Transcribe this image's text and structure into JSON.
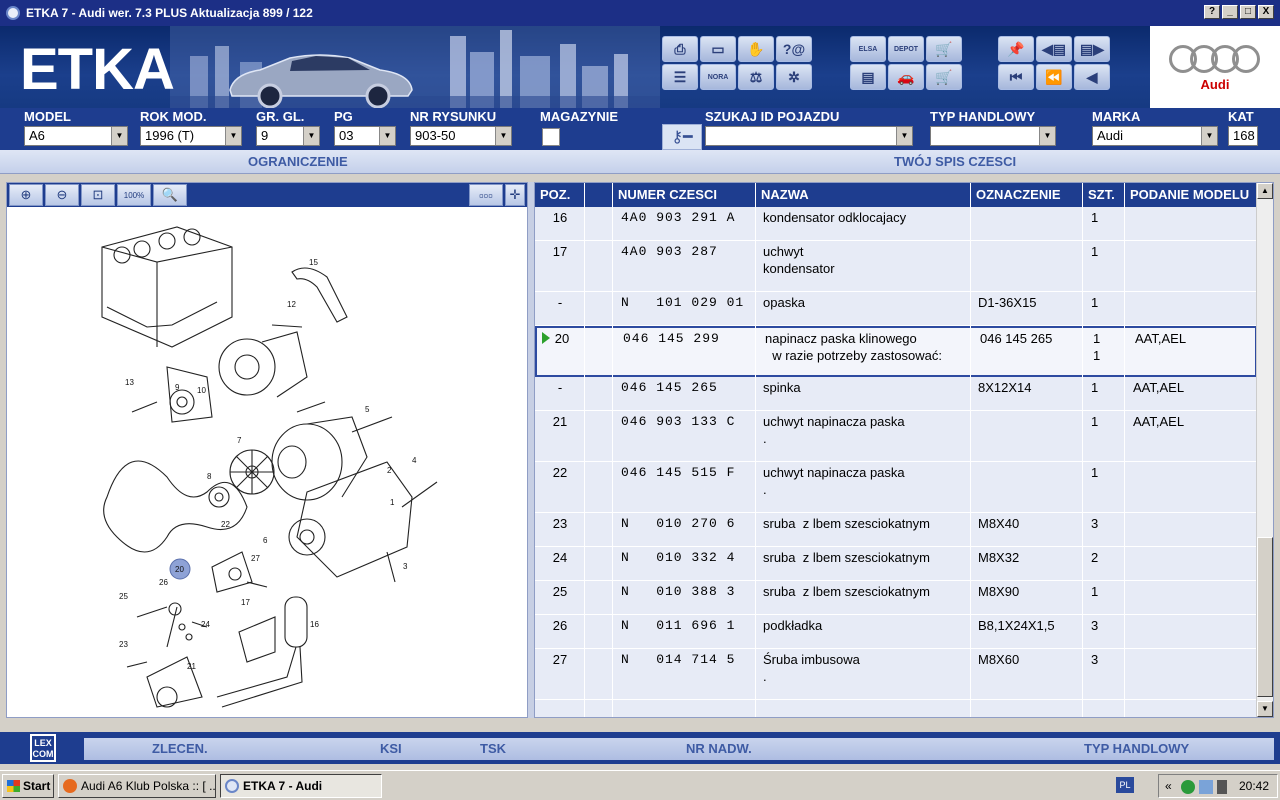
{
  "window": {
    "title": "ETKA 7 - Audi wer. 7.3 PLUS Aktualizacja 899 / 122",
    "buttons": [
      "?",
      "_",
      "□",
      "X"
    ]
  },
  "banner": {
    "logo": "ETKA",
    "brand": "Audi",
    "icon_labels": {
      "elsa": "ELSA",
      "depot": "DEPOT",
      "nora": "NORA"
    }
  },
  "selectors": {
    "model": {
      "label": "MODEL",
      "value": "A6"
    },
    "rok_mod": {
      "label": "ROK MOD.",
      "value": "1996 (T)"
    },
    "gr_gl": {
      "label": "GR. GL.",
      "value": "9"
    },
    "pg": {
      "label": "PG",
      "value": "03"
    },
    "nr_rysunku": {
      "label": "NR RYSUNKU",
      "value": "903-50"
    },
    "magazynie": {
      "label": "MAGAZYNIE"
    },
    "szukaj_id": {
      "label": "SZUKAJ ID POJAZDU",
      "value": ""
    },
    "typ_handlowy": {
      "label": "TYP HANDLOWY",
      "value": ""
    },
    "marka": {
      "label": "MARKA",
      "value": "Audi"
    },
    "kat": {
      "label": "KAT",
      "value": "168"
    }
  },
  "subheader": {
    "left": "OGRANICZENIE",
    "right": "TWÓJ SPIS CZESCI"
  },
  "toolbar": {
    "zoom_100": "100%"
  },
  "table": {
    "headers": {
      "poz": "POZ.",
      "numer": "NUMER CZESCI",
      "nazwa": "NAZWA",
      "oznaczenie": "OZNACZENIE",
      "szt": "SZT.",
      "podanie": "PODANIE MODELU"
    },
    "rows": [
      {
        "poz": "16",
        "numer": "4A0 903 291 A",
        "nazwa": "kondensator odklocajacy",
        "nazwa2": "",
        "ozn": "",
        "ozn2": "",
        "szt": "1",
        "szt2": "",
        "model": ""
      },
      {
        "poz": "17",
        "numer": "4A0 903 287",
        "nazwa": "uchwyt",
        "nazwa2": "kondensator",
        "ozn": "",
        "ozn2": "",
        "szt": "1",
        "szt2": "",
        "model": ""
      },
      {
        "poz": "-",
        "numer": "N   101 029 01",
        "nazwa": "opaska",
        "nazwa2": "",
        "ozn": "D1-36X15",
        "ozn2": "",
        "szt": "1",
        "szt2": "",
        "model": ""
      },
      {
        "poz": "20",
        "numer": "046 145 299",
        "nazwa": "napinacz paska klinowego",
        "nazwa2": "  w razie potrzeby zastosować:",
        "ozn": "",
        "ozn2": "046 145 265",
        "szt": "1",
        "szt2": "1",
        "model": "AAT,AEL"
      },
      {
        "poz": "-",
        "numer": "046 145 265",
        "nazwa": "spinka",
        "nazwa2": "",
        "ozn": "8X12X14",
        "ozn2": "",
        "szt": "1",
        "szt2": "",
        "model": "AAT,AEL"
      },
      {
        "poz": "21",
        "numer": "046 903 133 C",
        "nazwa": "uchwyt napinacza paska",
        "nazwa2": ".",
        "ozn": "",
        "ozn2": "",
        "szt": "1",
        "szt2": "",
        "model": "AAT,AEL"
      },
      {
        "poz": "22",
        "numer": "046 145 515 F",
        "nazwa": "uchwyt napinacza paska",
        "nazwa2": ".",
        "ozn": "",
        "ozn2": "",
        "szt": "1",
        "szt2": "",
        "model": ""
      },
      {
        "poz": "23",
        "numer": "N   010 270 6",
        "nazwa": "sruba  z lbem szesciokatnym",
        "nazwa2": "",
        "ozn": "M8X40",
        "ozn2": "",
        "szt": "3",
        "szt2": "",
        "model": ""
      },
      {
        "poz": "24",
        "numer": "N   010 332 4",
        "nazwa": "sruba  z lbem szesciokatnym",
        "nazwa2": "",
        "ozn": "M8X32",
        "ozn2": "",
        "szt": "2",
        "szt2": "",
        "model": ""
      },
      {
        "poz": "25",
        "numer": "N   010 388 3",
        "nazwa": "sruba  z lbem szesciokatnym",
        "nazwa2": "",
        "ozn": "M8X90",
        "ozn2": "",
        "szt": "1",
        "szt2": "",
        "model": ""
      },
      {
        "poz": "26",
        "numer": "N   011 696 1",
        "nazwa": "podkładka",
        "nazwa2": "",
        "ozn": "B8,1X24X1,5",
        "ozn2": "",
        "szt": "3",
        "szt2": "",
        "model": ""
      },
      {
        "poz": "27",
        "numer": "N   014 714 5",
        "nazwa": "Śruba imbusowa",
        "nazwa2": ".",
        "ozn": "M8X60",
        "ozn2": "",
        "szt": "3",
        "szt2": "",
        "model": ""
      }
    ]
  },
  "diagram_labels": [
    "15",
    "12",
    "13",
    "10",
    "9",
    "5",
    "7",
    "8",
    "4",
    "2",
    "1",
    "6",
    "3",
    "22",
    "27",
    "20",
    "26",
    "25",
    "24",
    "17",
    "16",
    "23",
    "21"
  ],
  "bottombar": {
    "lexcom": "LEX COM",
    "zlecen": "ZLECEN.",
    "ksi": "KSI",
    "tsk": "TSK",
    "nr_nadw": "NR NADW.",
    "typ_handlowy": "TYP HANDLOWY"
  },
  "taskbar": {
    "start": "Start",
    "task1": "Audi A6 Klub Polska :: [ ...",
    "task2": "ETKA 7 - Audi",
    "lang": "PL",
    "tray_chevron": "«",
    "clock": "20:42"
  },
  "colors": {
    "header_blue": "#1e3d8f",
    "title_blue": "#1c2f86",
    "row_bg": "#e7ebf6",
    "selected_border": "#2d4aa0",
    "audi_red": "#cc0000"
  }
}
